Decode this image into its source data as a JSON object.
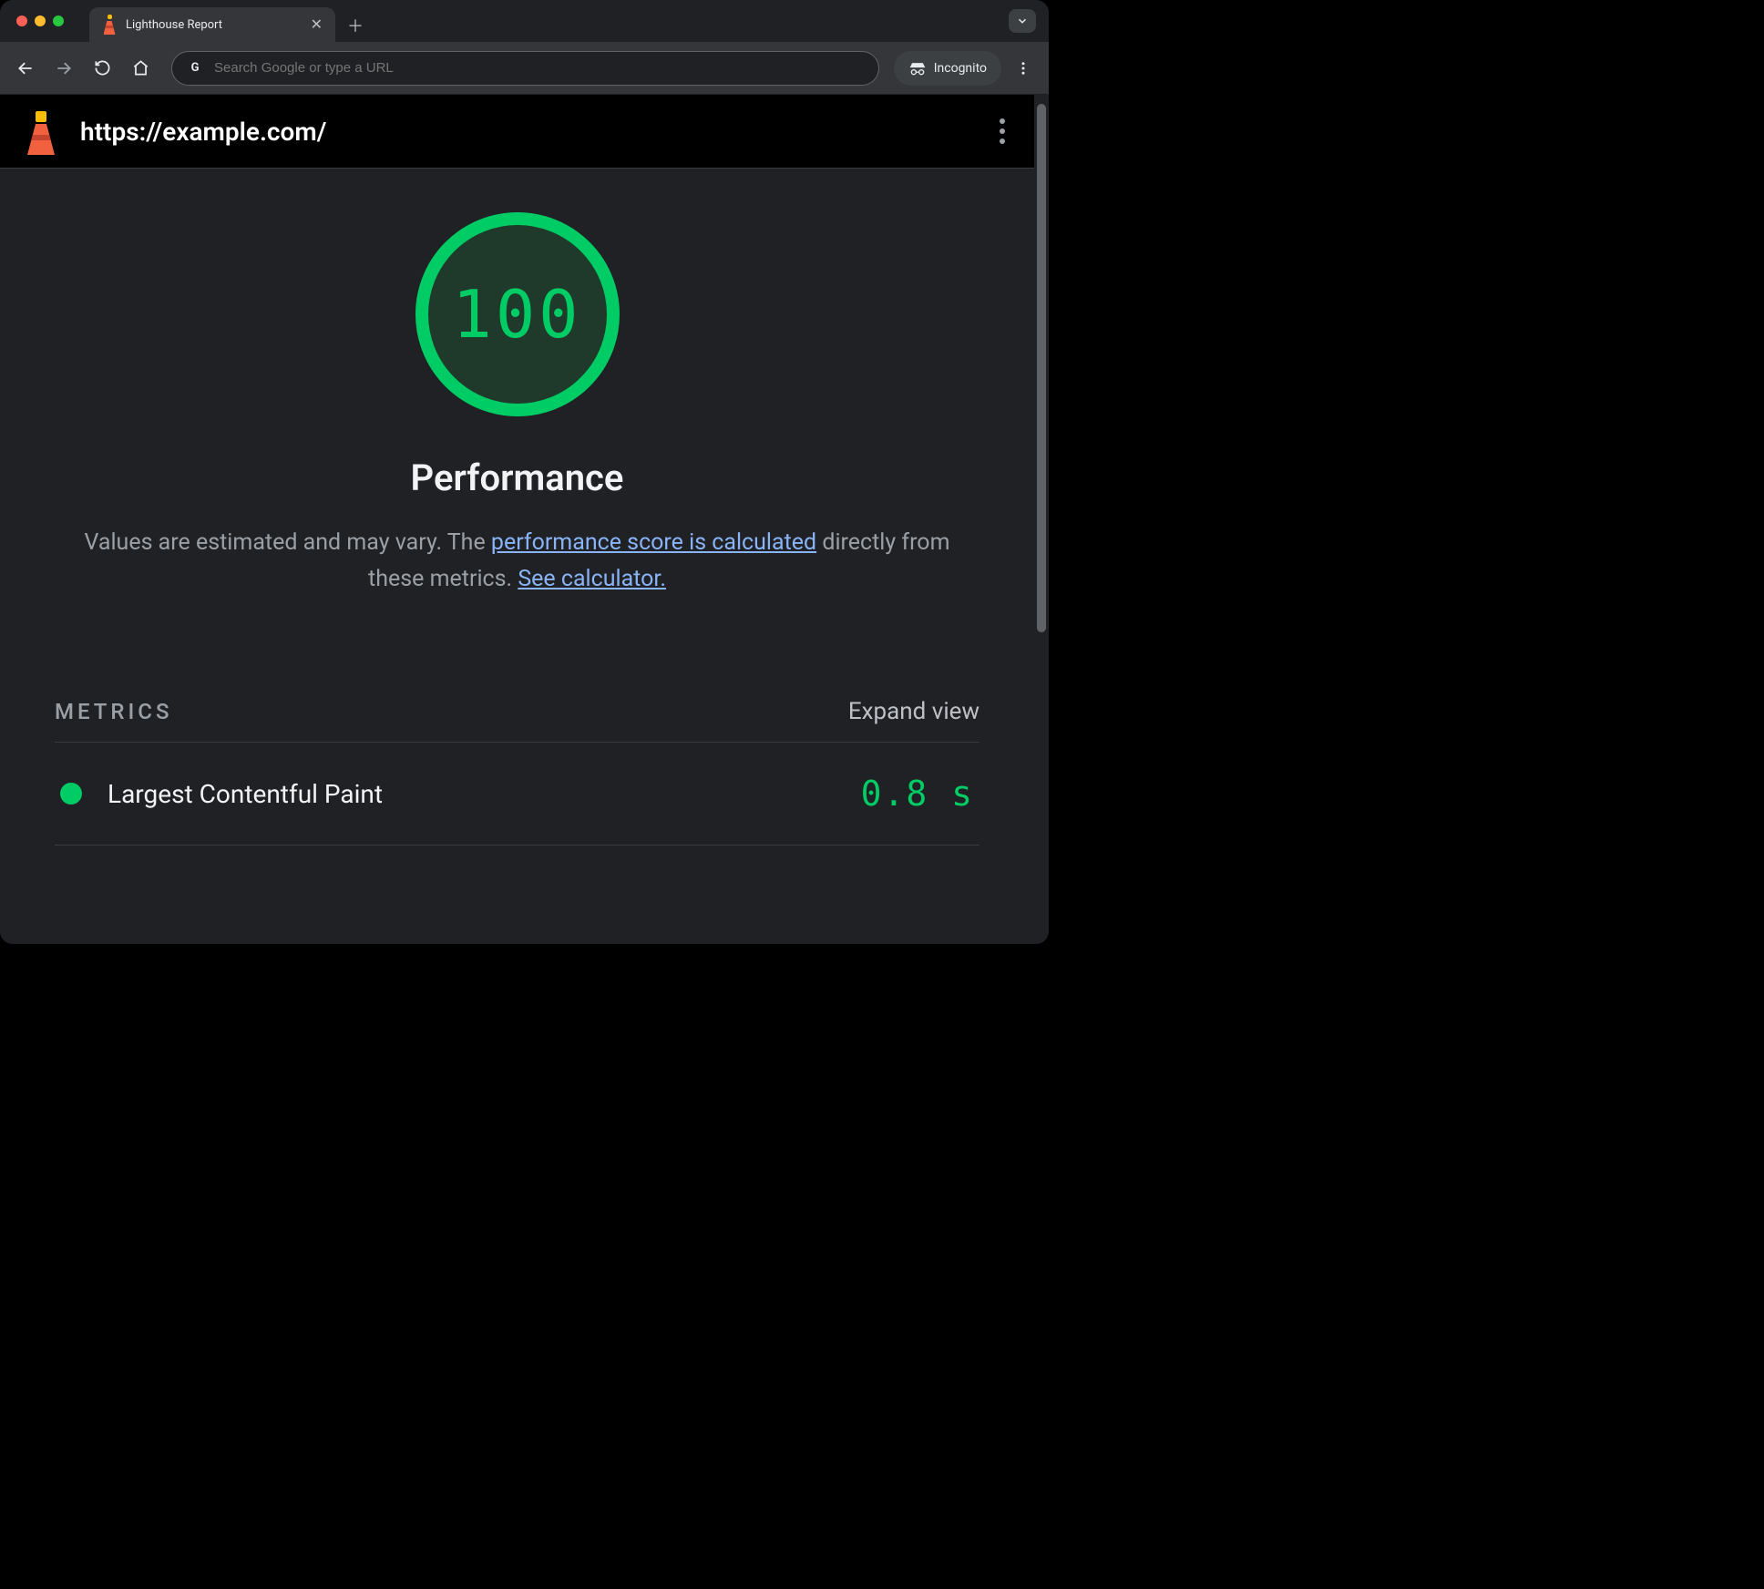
{
  "browser": {
    "tab_title": "Lighthouse Report",
    "omnibox_placeholder": "Search Google or type a URL",
    "incognito_label": "Incognito"
  },
  "report": {
    "url": "https://example.com/",
    "score": "100",
    "category": "Performance",
    "disclaimer_prefix": "Values are estimated and may vary. The ",
    "disclaimer_link1": "performance score is calculated",
    "disclaimer_middle": " directly from these metrics. ",
    "disclaimer_link2": "See calculator.",
    "metrics_label": "METRICS",
    "expand_label": "Expand view",
    "metrics": [
      {
        "name": "Largest Contentful Paint",
        "value": "0.8 s"
      }
    ]
  },
  "colors": {
    "pass": "#00cc66",
    "link": "#8ab4f8"
  }
}
